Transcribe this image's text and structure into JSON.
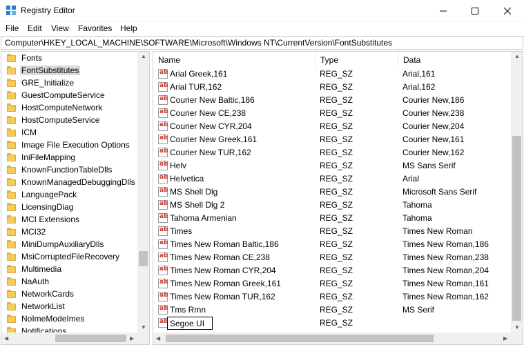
{
  "window": {
    "title": "Registry Editor"
  },
  "menu": [
    "File",
    "Edit",
    "View",
    "Favorites",
    "Help"
  ],
  "address": "Computer\\HKEY_LOCAL_MACHINE\\SOFTWARE\\Microsoft\\Windows NT\\CurrentVersion\\FontSubstitutes",
  "tree": {
    "selected": "FontSubstitutes",
    "items": [
      "Fonts",
      "FontSubstitutes",
      "GRE_Initialize",
      "GuestComputeService",
      "HostComputeNetwork",
      "HostComputeService",
      "ICM",
      "Image File Execution Options",
      "IniFileMapping",
      "KnownFunctionTableDlls",
      "KnownManagedDebuggingDlls",
      "LanguagePack",
      "LicensingDiag",
      "MCI Extensions",
      "MCI32",
      "MiniDumpAuxiliaryDlls",
      "MsiCorruptedFileRecovery",
      "Multimedia",
      "NaAuth",
      "NetworkCards",
      "NetworkList",
      "NoImeModeImes",
      "Notifications"
    ]
  },
  "columns": {
    "name": "Name",
    "type": "Type",
    "data": "Data"
  },
  "values": [
    {
      "name": "Arial Greek,161",
      "type": "REG_SZ",
      "data": "Arial,161"
    },
    {
      "name": "Arial TUR,162",
      "type": "REG_SZ",
      "data": "Arial,162"
    },
    {
      "name": "Courier New Baltic,186",
      "type": "REG_SZ",
      "data": "Courier New,186"
    },
    {
      "name": "Courier New CE,238",
      "type": "REG_SZ",
      "data": "Courier New,238"
    },
    {
      "name": "Courier New CYR,204",
      "type": "REG_SZ",
      "data": "Courier New,204"
    },
    {
      "name": "Courier New Greek,161",
      "type": "REG_SZ",
      "data": "Courier New,161"
    },
    {
      "name": "Courier New TUR,162",
      "type": "REG_SZ",
      "data": "Courier New,162"
    },
    {
      "name": "Helv",
      "type": "REG_SZ",
      "data": "MS Sans Serif"
    },
    {
      "name": "Helvetica",
      "type": "REG_SZ",
      "data": "Arial"
    },
    {
      "name": "MS Shell Dlg",
      "type": "REG_SZ",
      "data": "Microsoft Sans Serif"
    },
    {
      "name": "MS Shell Dlg 2",
      "type": "REG_SZ",
      "data": "Tahoma"
    },
    {
      "name": "Tahoma Armenian",
      "type": "REG_SZ",
      "data": "Tahoma"
    },
    {
      "name": "Times",
      "type": "REG_SZ",
      "data": "Times New Roman"
    },
    {
      "name": "Times New Roman Baltic,186",
      "type": "REG_SZ",
      "data": "Times New Roman,186"
    },
    {
      "name": "Times New Roman CE,238",
      "type": "REG_SZ",
      "data": "Times New Roman,238"
    },
    {
      "name": "Times New Roman CYR,204",
      "type": "REG_SZ",
      "data": "Times New Roman,204"
    },
    {
      "name": "Times New Roman Greek,161",
      "type": "REG_SZ",
      "data": "Times New Roman,161"
    },
    {
      "name": "Times New Roman TUR,162",
      "type": "REG_SZ",
      "data": "Times New Roman,162"
    },
    {
      "name": "Tms Rmn",
      "type": "REG_SZ",
      "data": "MS Serif"
    }
  ],
  "editing": {
    "name": "Segoe UI",
    "type": "REG_SZ"
  },
  "icons": {
    "app": "registry-editor-icon",
    "folder": "folder-icon",
    "value": "string-value-icon"
  },
  "colors": {
    "selection": "#d9d9d9",
    "folder": "#f5cc5a",
    "string_icon": "#c0392b"
  }
}
